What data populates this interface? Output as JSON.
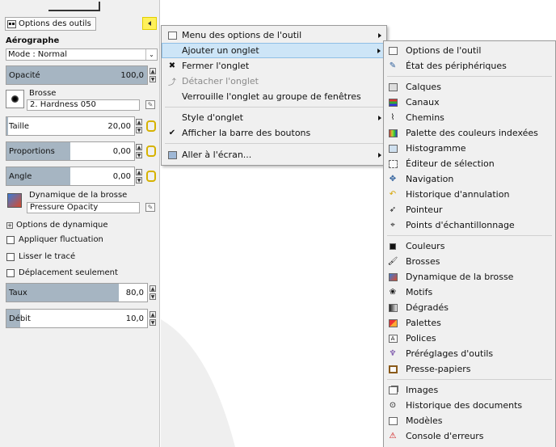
{
  "tool_options": {
    "tab_label": "Options des outils",
    "tool_name": "Aérographe",
    "mode_label": "Mode :",
    "mode_value": "Normal",
    "opacity": {
      "label": "Opacité",
      "value": "100,0",
      "fraction": 1.0
    },
    "brush_label": "Brosse",
    "brush_name": "2. Hardness 050",
    "size": {
      "label": "Taille",
      "value": "20,00",
      "fraction": 0.01
    },
    "aspect": {
      "label": "Proportions",
      "value": "0,00",
      "fraction": 0.5
    },
    "angle": {
      "label": "Angle",
      "value": "0,00",
      "fraction": 0.5
    },
    "dynamics_label": "Dynamique de la brosse",
    "dynamics_name": "Pressure Opacity",
    "dynamics_options": "Options de dynamique",
    "apply_jitter": "Appliquer fluctuation",
    "smooth_stroke": "Lisser le tracé",
    "move_only": "Déplacement seulement",
    "rate": {
      "label": "Taux",
      "value": "80,0",
      "fraction": 0.8
    },
    "flow": {
      "label": "Débit",
      "value": "10,0",
      "fraction": 0.1
    }
  },
  "tab_menu": {
    "items": [
      {
        "label": "Menu des options de l'outil",
        "icon": "tool-options-icon",
        "submenu": true
      },
      {
        "label": "Ajouter un onglet",
        "icon": "",
        "submenu": true,
        "highlighted": true
      },
      {
        "label": "Fermer l'onglet",
        "icon": "close-icon"
      },
      {
        "label": "Détacher l'onglet",
        "icon": "detach-icon",
        "disabled": true
      },
      {
        "label": "Verrouille l'onglet au groupe de fenêtres",
        "icon": ""
      },
      {
        "label": "Style d'onglet",
        "icon": "",
        "submenu": true
      },
      {
        "label": "Afficher la barre des boutons",
        "icon": "check-icon"
      },
      {
        "label": "Aller à l'écran...",
        "icon": "screen-icon",
        "submenu": true
      }
    ]
  },
  "add_tab_submenu": {
    "items": [
      {
        "label": "Options de l'outil",
        "icon": "tool-options-icon"
      },
      {
        "label": "État des périphériques",
        "icon": "device-status-icon"
      },
      {
        "label": "Calques",
        "icon": "layers-icon"
      },
      {
        "label": "Canaux",
        "icon": "channels-icon"
      },
      {
        "label": "Chemins",
        "icon": "paths-icon"
      },
      {
        "label": "Palette des couleurs indexées",
        "icon": "colormap-icon"
      },
      {
        "label": "Histogramme",
        "icon": "histogram-icon"
      },
      {
        "label": "Éditeur de sélection",
        "icon": "selection-editor-icon"
      },
      {
        "label": "Navigation",
        "icon": "navigation-icon"
      },
      {
        "label": "Historique d'annulation",
        "icon": "undo-history-icon"
      },
      {
        "label": "Pointeur",
        "icon": "pointer-icon"
      },
      {
        "label": "Points d'échantillonnage",
        "icon": "sample-points-icon"
      },
      {
        "label": "Couleurs",
        "icon": "colors-icon"
      },
      {
        "label": "Brosses",
        "icon": "brushes-icon"
      },
      {
        "label": "Dynamique de la brosse",
        "icon": "paint-dynamics-icon"
      },
      {
        "label": "Motifs",
        "icon": "patterns-icon"
      },
      {
        "label": "Dégradés",
        "icon": "gradients-icon"
      },
      {
        "label": "Palettes",
        "icon": "palettes-icon"
      },
      {
        "label": "Polices",
        "icon": "fonts-icon"
      },
      {
        "label": "Préréglages d'outils",
        "icon": "tool-presets-icon"
      },
      {
        "label": "Presse-papiers",
        "icon": "buffers-icon"
      },
      {
        "label": "Images",
        "icon": "images-icon"
      },
      {
        "label": "Historique des documents",
        "icon": "document-history-icon"
      },
      {
        "label": "Modèles",
        "icon": "templates-icon"
      },
      {
        "label": "Console d'erreurs",
        "icon": "error-console-icon"
      }
    ]
  },
  "colors": {
    "highlight": "#cde5f7",
    "slider_fill": "#a6b5c2",
    "tab_button": "#fff15a"
  }
}
